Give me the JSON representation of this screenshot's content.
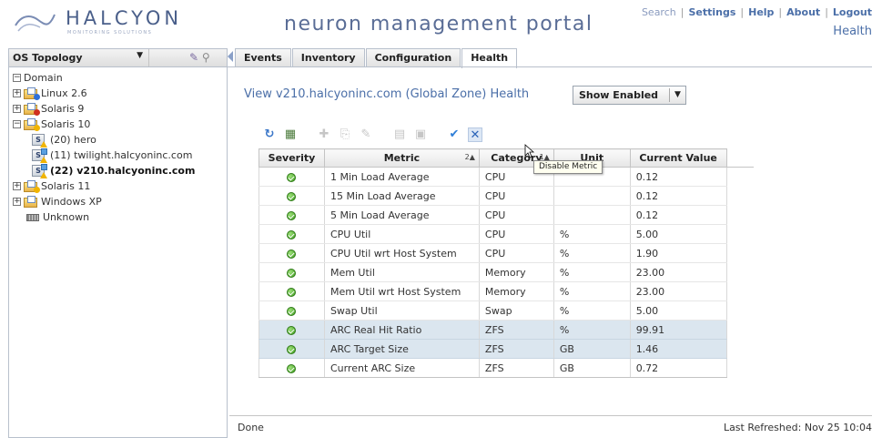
{
  "header": {
    "logo_text": "HALCYON",
    "logo_sub": "MONITORING SOLUTIONS",
    "portal_title": "neuron management portal",
    "links": [
      "Search",
      "Settings",
      "Help",
      "About",
      "Logout"
    ],
    "current_page": "Health"
  },
  "sidebar": {
    "selector_label": "OS Topology",
    "tree": [
      {
        "label": "Domain",
        "level": 0,
        "expander": "⊟"
      },
      {
        "label": "Linux 2.6",
        "level": 1,
        "expander": "⊞",
        "badge": "#2e6fd8"
      },
      {
        "label": "Solaris 9",
        "level": 1,
        "expander": "⊞",
        "badge": "#d03020"
      },
      {
        "label": "Solaris 10",
        "level": 1,
        "expander": "⊟",
        "badge": "#f0b400"
      },
      {
        "label": "(20) hero",
        "level": 2
      },
      {
        "label": "(11) twilight.halcyoninc.com",
        "level": 2,
        "zone": true
      },
      {
        "label": "(22) v210.halcyoninc.com",
        "level": 2,
        "zone": true,
        "selected": true
      },
      {
        "label": "Solaris 11",
        "level": 1,
        "expander": "⊞",
        "badge": "#f0b400"
      },
      {
        "label": "Windows XP",
        "level": 1,
        "expander": "⊞"
      },
      {
        "label": "Unknown",
        "level": 1
      }
    ]
  },
  "tabs": [
    "Events",
    "Inventory",
    "Configuration",
    "Health"
  ],
  "active_tab": "Health",
  "main": {
    "view_title": "View v210.halcyoninc.com (Global Zone) Health",
    "filter": "Show Enabled",
    "tooltip": "Disable Metric"
  },
  "table": {
    "columns": [
      "Severity",
      "Metric",
      "Category",
      "Unit",
      "Current Value"
    ],
    "metric_sort": "2▲",
    "category_sort": "1▲",
    "rows": [
      {
        "metric": "1 Min Load Average",
        "category": "CPU",
        "unit": "",
        "value": "0.12",
        "selected": false
      },
      {
        "metric": "15 Min Load Average",
        "category": "CPU",
        "unit": "",
        "value": "0.12",
        "selected": false
      },
      {
        "metric": "5 Min Load Average",
        "category": "CPU",
        "unit": "",
        "value": "0.12",
        "selected": false
      },
      {
        "metric": "CPU Util",
        "category": "CPU",
        "unit": "%",
        "value": "5.00",
        "selected": false
      },
      {
        "metric": "CPU Util wrt Host System",
        "category": "CPU",
        "unit": "%",
        "value": "1.90",
        "selected": false
      },
      {
        "metric": "Mem Util",
        "category": "Memory",
        "unit": "%",
        "value": "23.00",
        "selected": false
      },
      {
        "metric": "Mem Util wrt Host System",
        "category": "Memory",
        "unit": "%",
        "value": "23.00",
        "selected": false
      },
      {
        "metric": "Swap Util",
        "category": "Swap",
        "unit": "%",
        "value": "5.00",
        "selected": false
      },
      {
        "metric": "ARC Real Hit Ratio",
        "category": "ZFS",
        "unit": "%",
        "value": "99.91",
        "selected": true
      },
      {
        "metric": "ARC Target Size",
        "category": "ZFS",
        "unit": "GB",
        "value": "1.46",
        "selected": true
      },
      {
        "metric": "Current ARC Size",
        "category": "ZFS",
        "unit": "GB",
        "value": "0.72",
        "selected": false
      }
    ]
  },
  "status": {
    "left": "Done",
    "right": "Last Refreshed: Nov 25 10:04"
  },
  "colors": {
    "accent": "#4b6fa8",
    "selected_row": "#dbe6ef",
    "ok": "#3f9e1e"
  }
}
